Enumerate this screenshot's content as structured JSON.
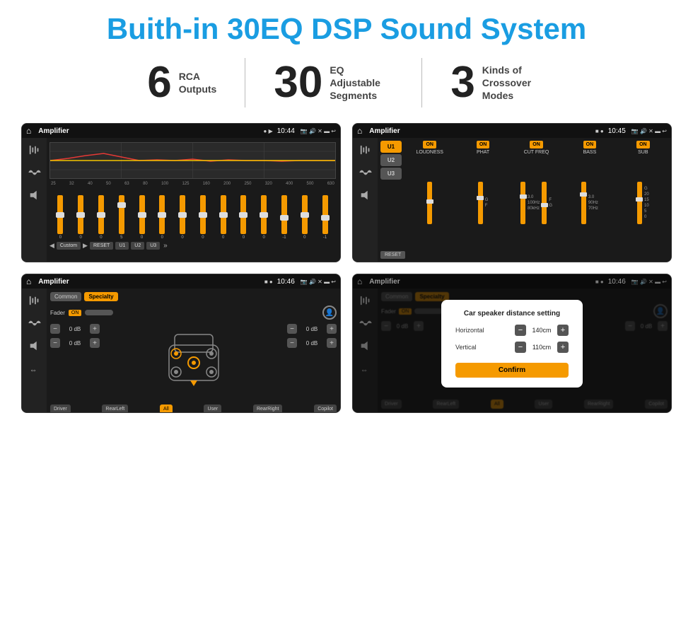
{
  "header": {
    "title": "Buith-in 30EQ DSP Sound System"
  },
  "stats": [
    {
      "number": "6",
      "label": "RCA\nOutputs"
    },
    {
      "number": "30",
      "label": "EQ Adjustable\nSegments"
    },
    {
      "number": "3",
      "label": "Kinds of\nCrossover Modes"
    }
  ],
  "screens": {
    "eq": {
      "statusTitle": "Amplifier",
      "statusTime": "10:44",
      "freqLabels": [
        "25",
        "32",
        "40",
        "50",
        "63",
        "80",
        "100",
        "125",
        "160",
        "200",
        "250",
        "320",
        "400",
        "500",
        "630"
      ],
      "sliderValues": [
        "0",
        "0",
        "0",
        "5",
        "0",
        "0",
        "0",
        "0",
        "0",
        "0",
        "0",
        "-1",
        "0",
        "-1"
      ],
      "bottomButtons": [
        "Custom",
        "RESET",
        "U1",
        "U2",
        "U3"
      ]
    },
    "crossover": {
      "statusTitle": "Amplifier",
      "statusTime": "10:45",
      "uButtons": [
        "U1",
        "U2",
        "U3"
      ],
      "channels": [
        {
          "label": "LOUDNESS",
          "on": true
        },
        {
          "label": "PHAT",
          "on": true
        },
        {
          "label": "CUT FREQ",
          "on": true
        },
        {
          "label": "BASS",
          "on": true
        },
        {
          "label": "SUB",
          "on": true
        }
      ]
    },
    "fader": {
      "statusTitle": "Amplifier",
      "statusTime": "10:46",
      "tabs": [
        "Common",
        "Specialty"
      ],
      "activeTab": 1,
      "faderLabel": "Fader",
      "faderOn": "ON",
      "dbValues": [
        "0 dB",
        "0 dB",
        "0 dB",
        "0 dB"
      ],
      "bottomButtons": [
        "Driver",
        "RearLeft",
        "All",
        "User",
        "RearRight",
        "Copilot"
      ]
    },
    "distance": {
      "statusTitle": "Amplifier",
      "statusTime": "10:46",
      "tabs": [
        "Common",
        "Specialty"
      ],
      "dialogTitle": "Car speaker distance setting",
      "horizontal": {
        "label": "Horizontal",
        "value": "140cm"
      },
      "vertical": {
        "label": "Vertical",
        "value": "110cm"
      },
      "confirmLabel": "Confirm",
      "dbValues": [
        "0 dB",
        "0 dB"
      ],
      "bottomButtons": [
        "Driver",
        "RearLeft",
        "All",
        "User",
        "RearRight",
        "Copilot"
      ]
    }
  },
  "icons": {
    "home": "⌂",
    "back": "↩",
    "minus": "−",
    "plus": "+",
    "play": "▶",
    "prev": "◀",
    "more": "»",
    "settings": "⚙"
  }
}
